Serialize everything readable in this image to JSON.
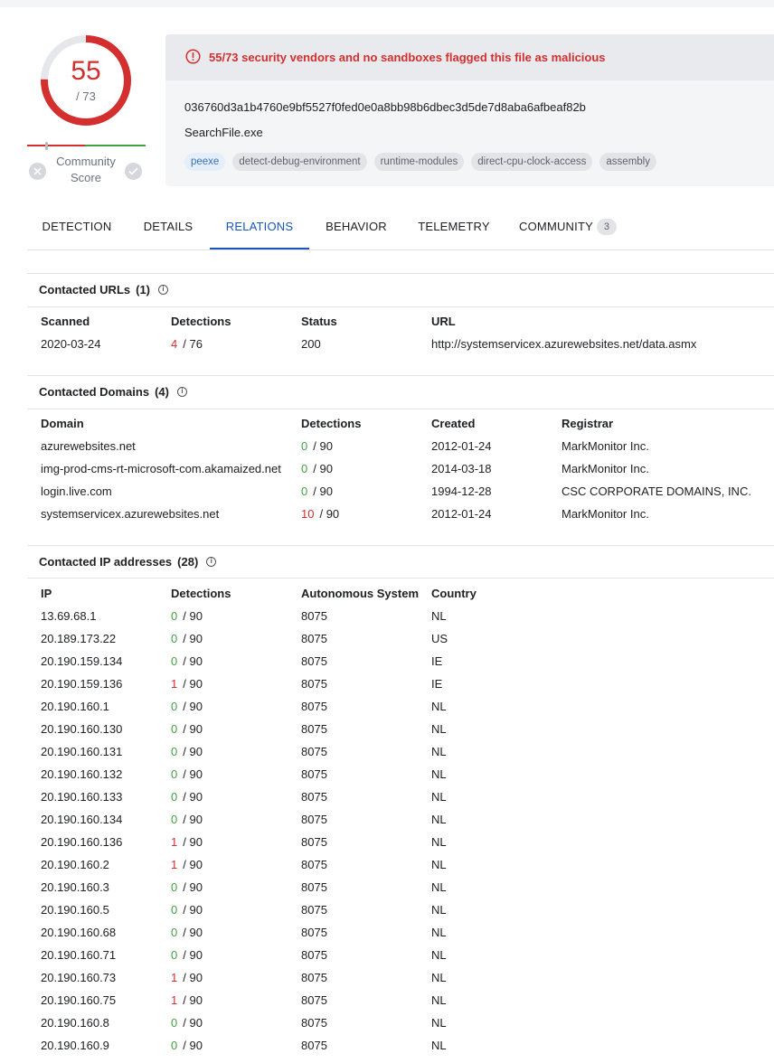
{
  "score": {
    "positives": "55",
    "total": "/ 73",
    "ratio": 0.753,
    "color": "#d32f2f",
    "community_label": "Community Score",
    "community_label_line1": "Community",
    "community_label_line2": "Score"
  },
  "alert": {
    "text": "55/73 security vendors and no sandboxes flagged this file as malicious",
    "icon": "exclamation-circle-icon"
  },
  "file": {
    "hash": "036760d3a1b4760e9bf5527f0fed0e0a8bb98b6dbec3d5de7d8aba6afbeaf82b",
    "name": "SearchFile.exe",
    "tags": [
      "peexe",
      "detect-debug-environment",
      "runtime-modules",
      "direct-cpu-clock-access",
      "assembly"
    ]
  },
  "tabs": {
    "detection": "DETECTION",
    "details": "DETAILS",
    "relations": "RELATIONS",
    "behavior": "BEHAVIOR",
    "telemetry": "TELEMETRY",
    "community": "COMMUNITY",
    "community_count": "3"
  },
  "urls": {
    "title": "Contacted URLs",
    "count": "(1)",
    "headers": [
      "Scanned",
      "Detections",
      "Status",
      "URL"
    ],
    "rows": [
      [
        "2020-03-24",
        "4",
        "/ 76",
        "200",
        "http://systemservicex.azurewebsites.net/data.asmx"
      ]
    ]
  },
  "domains": {
    "title": "Contacted Domains",
    "count": "(4)",
    "headers": [
      "Domain",
      "Detections",
      "Created",
      "Registrar"
    ],
    "rows": [
      [
        "azurewebsites.net",
        "0",
        "/ 90",
        "2012-01-24",
        "MarkMonitor Inc."
      ],
      [
        "img-prod-cms-rt-microsoft-com.akamaized.net",
        "0",
        "/ 90",
        "2014-03-18",
        "MarkMonitor Inc."
      ],
      [
        "login.live.com",
        "0",
        "/ 90",
        "1994-12-28",
        "CSC CORPORATE DOMAINS, INC."
      ],
      [
        "systemservicex.azurewebsites.net",
        "10",
        "/ 90",
        "2012-01-24",
        "MarkMonitor Inc."
      ]
    ]
  },
  "ips": {
    "title": "Contacted IP addresses",
    "count": "(28)",
    "headers": [
      "IP",
      "Detections",
      "Autonomous System",
      "Country"
    ],
    "rows": [
      [
        "13.69.68.1",
        "0",
        "/ 90",
        "8075",
        "NL"
      ],
      [
        "20.189.173.22",
        "0",
        "/ 90",
        "8075",
        "US"
      ],
      [
        "20.190.159.134",
        "0",
        "/ 90",
        "8075",
        "IE"
      ],
      [
        "20.190.159.136",
        "1",
        "/ 90",
        "8075",
        "IE"
      ],
      [
        "20.190.160.1",
        "0",
        "/ 90",
        "8075",
        "NL"
      ],
      [
        "20.190.160.130",
        "0",
        "/ 90",
        "8075",
        "NL"
      ],
      [
        "20.190.160.131",
        "0",
        "/ 90",
        "8075",
        "NL"
      ],
      [
        "20.190.160.132",
        "0",
        "/ 90",
        "8075",
        "NL"
      ],
      [
        "20.190.160.133",
        "0",
        "/ 90",
        "8075",
        "NL"
      ],
      [
        "20.190.160.134",
        "0",
        "/ 90",
        "8075",
        "NL"
      ],
      [
        "20.190.160.136",
        "1",
        "/ 90",
        "8075",
        "NL"
      ],
      [
        "20.190.160.2",
        "1",
        "/ 90",
        "8075",
        "NL"
      ],
      [
        "20.190.160.3",
        "0",
        "/ 90",
        "8075",
        "NL"
      ],
      [
        "20.190.160.5",
        "0",
        "/ 90",
        "8075",
        "NL"
      ],
      [
        "20.190.160.68",
        "0",
        "/ 90",
        "8075",
        "NL"
      ],
      [
        "20.190.160.71",
        "0",
        "/ 90",
        "8075",
        "NL"
      ],
      [
        "20.190.160.73",
        "1",
        "/ 90",
        "8075",
        "NL"
      ],
      [
        "20.190.160.75",
        "1",
        "/ 90",
        "8075",
        "NL"
      ],
      [
        "20.190.160.8",
        "0",
        "/ 90",
        "8075",
        "NL"
      ],
      [
        "20.190.160.9",
        "0",
        "/ 90",
        "8075",
        "NL"
      ]
    ]
  },
  "colors": {
    "malicious": "#d32f2f",
    "clean": "#43a047",
    "accent": "#1a56b8"
  }
}
